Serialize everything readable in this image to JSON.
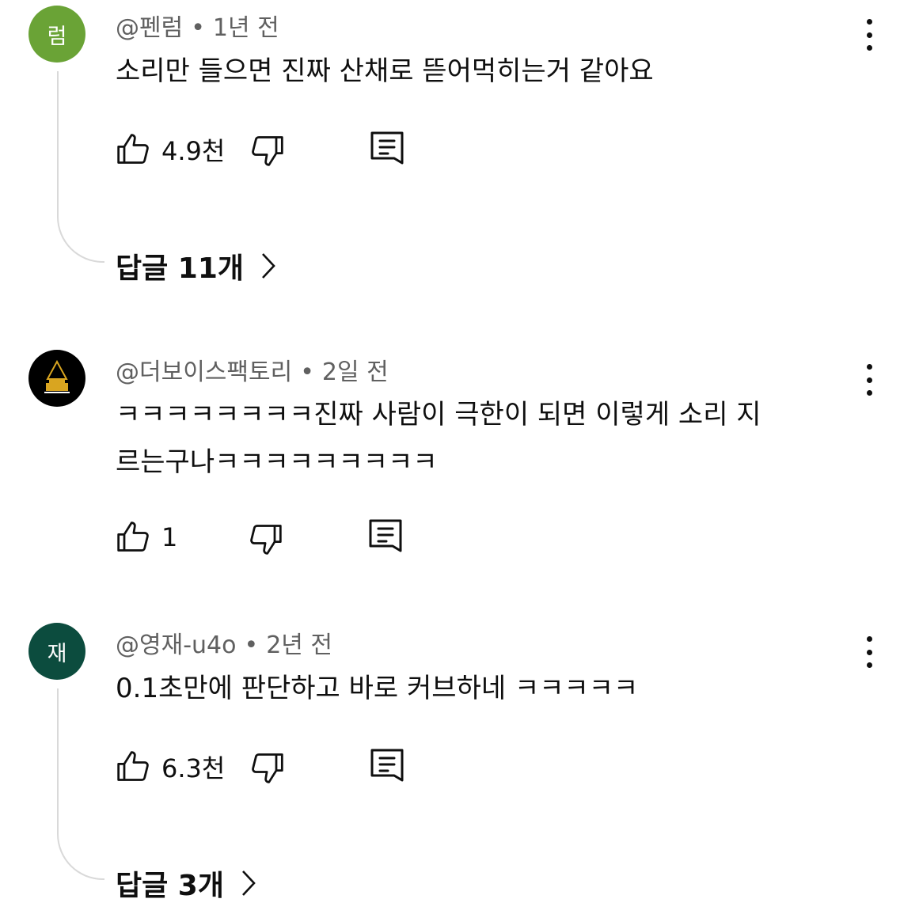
{
  "comments": [
    {
      "avatar_text": "럼",
      "avatar_color": "#6aa336",
      "author": "@펜럼",
      "time": "1년 전",
      "text_lines": [
        "소리만 들으면 진짜 산채로 뜯어먹히는거 같아요"
      ],
      "likes": "4.9천",
      "replies": "답글 11개"
    },
    {
      "avatar_text": "",
      "avatar_color": "#000000",
      "author": "@더보이스팩토리",
      "time": "2일 전",
      "text_lines": [
        "ㅋㅋㅋㅋㅋㅋㅋㅋ진짜 사람이 극한이 되면 이렇게 소리 지",
        "르는구나ㅋㅋㅋㅋㅋㅋㅋㅋㅋ"
      ],
      "likes": "1",
      "replies": ""
    },
    {
      "avatar_text": "재",
      "avatar_color": "#0c4c3e",
      "author": "@영재-u4o",
      "time": "2년 전",
      "text_lines": [
        "0.1초만에 판단하고 바로 커브하네 ㅋㅋㅋㅋㅋ"
      ],
      "likes": "6.3천",
      "replies": "답글 3개"
    }
  ],
  "icons": {
    "like": "thumbs-up-icon",
    "dislike": "thumbs-down-icon",
    "reply": "comment-icon",
    "menu": "more-vertical-icon",
    "chevron": "chevron-right-icon"
  }
}
